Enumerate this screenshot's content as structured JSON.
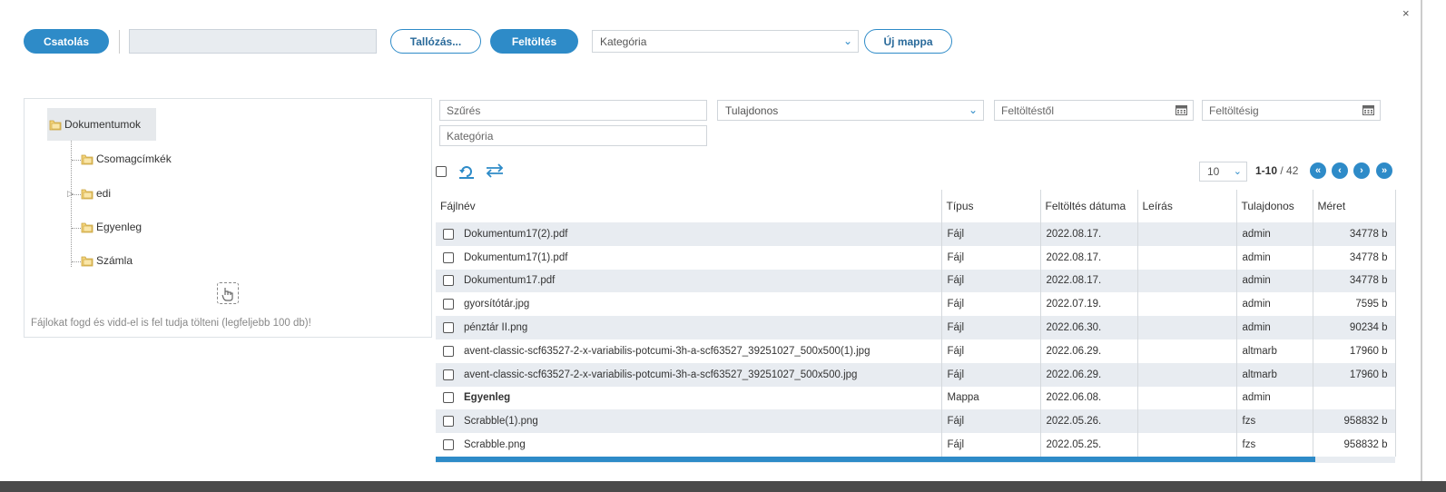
{
  "header": {
    "close_label": "×",
    "attach_label": "Csatolás",
    "browse_label": "Tallózás...",
    "upload_label": "Feltöltés",
    "category_select_value": "Kategória",
    "new_folder_label": "Új mappa"
  },
  "tree": {
    "root": "Dokumentumok",
    "items": [
      {
        "label": "Csomagcímkék"
      },
      {
        "label": "edi"
      },
      {
        "label": "Egyenleg"
      },
      {
        "label": "Számla"
      }
    ],
    "drop_hint": "Fájlokat fogd és vidd-el is fel tudja tölteni (legfeljebb 100 db)!"
  },
  "filters": {
    "search_placeholder": "Szűrés",
    "owner_select": "Tulajdonos",
    "from_date_placeholder": "Feltöltéstől",
    "to_date_placeholder": "Feltöltésig",
    "category_placeholder": "Kategória"
  },
  "pager": {
    "page_size": "10",
    "range": "1-10",
    "total": "/ 42",
    "first": "«",
    "prev": "‹",
    "next": "›",
    "last": "»"
  },
  "table": {
    "columns": [
      "Fájlnév",
      "Típus",
      "Feltöltés dátuma",
      "Leírás",
      "Tulajdonos",
      "Méret"
    ],
    "rows": [
      {
        "name": "Dokumentum17(2).pdf",
        "type": "Fájl",
        "date": "2022.08.17.",
        "desc": "",
        "owner": "admin",
        "size": "34778 b"
      },
      {
        "name": "Dokumentum17(1).pdf",
        "type": "Fájl",
        "date": "2022.08.17.",
        "desc": "",
        "owner": "admin",
        "size": "34778 b"
      },
      {
        "name": "Dokumentum17.pdf",
        "type": "Fájl",
        "date": "2022.08.17.",
        "desc": "",
        "owner": "admin",
        "size": "34778 b"
      },
      {
        "name": "gyorsítótár.jpg",
        "type": "Fájl",
        "date": "2022.07.19.",
        "desc": "",
        "owner": "admin",
        "size": "7595 b"
      },
      {
        "name": "pénztár II.png",
        "type": "Fájl",
        "date": "2022.06.30.",
        "desc": "",
        "owner": "admin",
        "size": "90234 b"
      },
      {
        "name": "avent-classic-scf63527-2-x-variabilis-potcumi-3h-a-scf63527_39251027_500x500(1).jpg",
        "type": "Fájl",
        "date": "2022.06.29.",
        "desc": "",
        "owner": "altmarb",
        "size": "17960 b"
      },
      {
        "name": "avent-classic-scf63527-2-x-variabilis-potcumi-3h-a-scf63527_39251027_500x500.jpg",
        "type": "Fájl",
        "date": "2022.06.29.",
        "desc": "",
        "owner": "altmarb",
        "size": "17960 b"
      },
      {
        "name": "Egyenleg",
        "type": "Mappa",
        "date": "2022.06.08.",
        "desc": "",
        "owner": "admin",
        "size": ""
      },
      {
        "name": "Scrabble(1).png",
        "type": "Fájl",
        "date": "2022.05.26.",
        "desc": "",
        "owner": "fzs",
        "size": "958832 b"
      },
      {
        "name": "Scrabble.png",
        "type": "Fájl",
        "date": "2022.05.25.",
        "desc": "",
        "owner": "fzs",
        "size": "958832 b"
      }
    ]
  },
  "colors": {
    "accent": "#2e8bc8",
    "row_alt": "#e8ecf1"
  },
  "icons": {
    "folder": "folder-icon",
    "refresh": "refresh-icon",
    "swap": "swap-icon",
    "calendar": "calendar-icon",
    "drop": "hand-pointer-icon"
  }
}
